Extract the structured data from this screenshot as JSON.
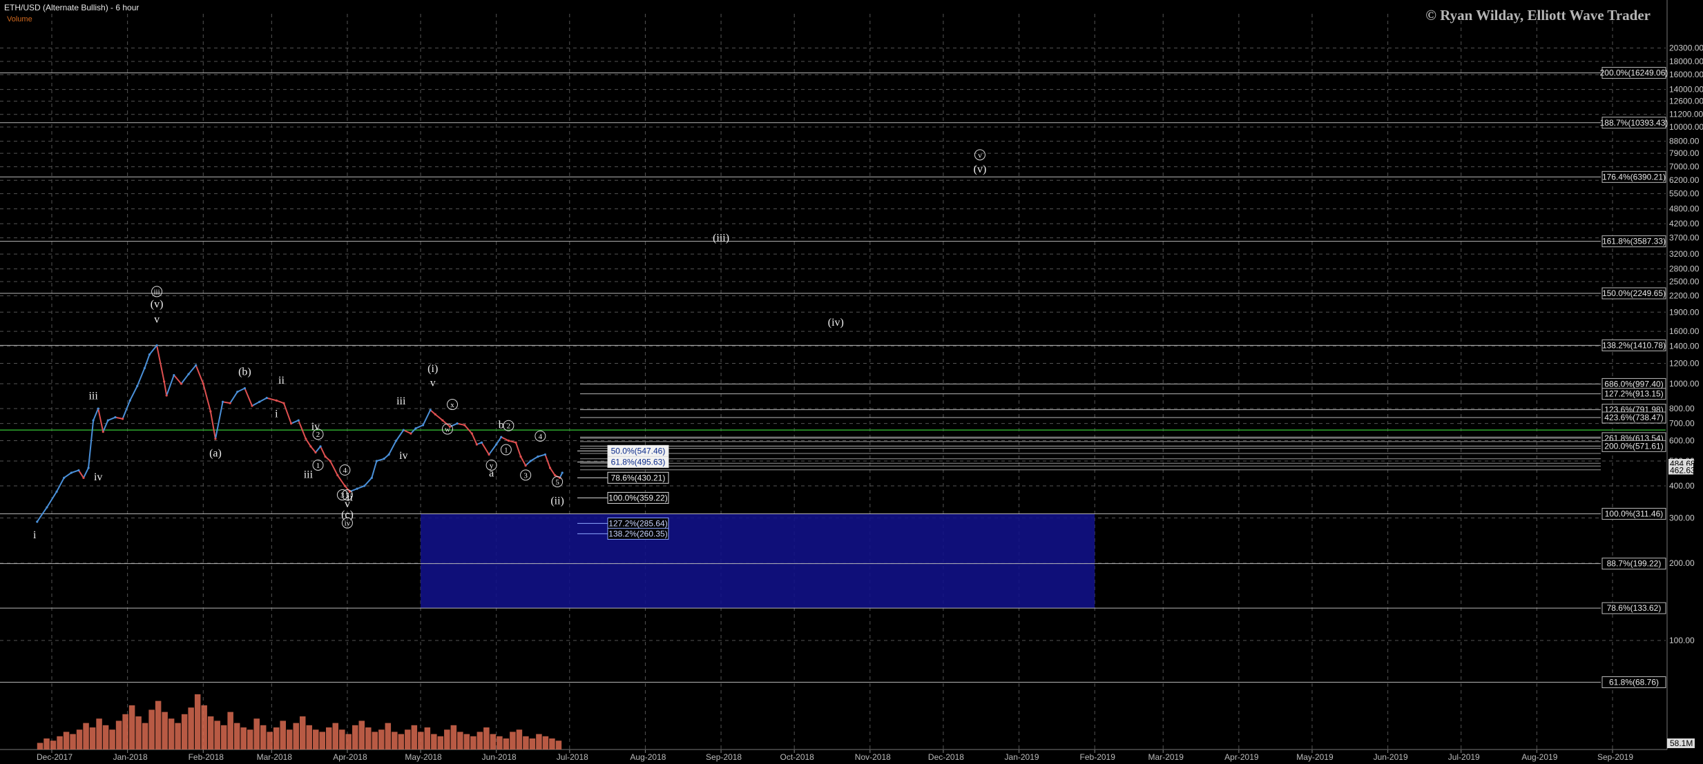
{
  "header": {
    "title": "ETH/USD (Alternate Bullish) - 6 hour",
    "volume_label": "Volume",
    "copyright": "© Ryan Wilday, Elliott Wave Trader"
  },
  "colors": {
    "background": "#000000",
    "grid": "#555555",
    "up_candle": "#4a90d9",
    "down_candle": "#e05050",
    "green_line": "#2ea82e",
    "target_box": "#11118a",
    "volume": "#d86a50"
  },
  "chart_data": {
    "type": "line",
    "scale": "log",
    "title": "ETH/USD (Alternate Bullish) - 6 hour",
    "x_ticks": [
      "Dec-2017",
      "Jan-2018",
      "Feb-2018",
      "Mar-2018",
      "Apr-2018",
      "May-2018",
      "Jun-2018",
      "Jul-2018",
      "Aug-2018",
      "Sep-2018",
      "Oct-2018",
      "Nov-2018",
      "Dec-2018",
      "Jan-2019",
      "Feb-2019",
      "Mar-2019",
      "Apr-2019",
      "May-2019",
      "Jun-2019",
      "Jul-2019",
      "Aug-2019",
      "Sep-2019"
    ],
    "y_ticks": [
      20300,
      18000,
      16000,
      14000,
      12600,
      11200,
      10000,
      8800,
      7900,
      7000,
      6200,
      5500,
      4800,
      4200,
      3700,
      3200,
      2800,
      2500,
      2200,
      1900,
      1600,
      1400,
      1200,
      1000,
      800,
      700,
      600,
      500,
      400,
      300,
      200,
      100
    ],
    "ylim": [
      50,
      20300
    ],
    "price_series": [
      [
        "2017-11-25",
        290
      ],
      [
        "2017-11-29",
        330
      ],
      [
        "2017-12-03",
        380
      ],
      [
        "2017-12-06",
        430
      ],
      [
        "2017-12-09",
        450
      ],
      [
        "2017-12-12",
        460
      ],
      [
        "2017-12-14",
        430
      ],
      [
        "2017-12-16",
        470
      ],
      [
        "2017-12-18",
        720
      ],
      [
        "2017-12-20",
        800
      ],
      [
        "2017-12-22",
        650
      ],
      [
        "2017-12-24",
        720
      ],
      [
        "2017-12-27",
        740
      ],
      [
        "2017-12-30",
        730
      ],
      [
        "2018-01-02",
        860
      ],
      [
        "2018-01-05",
        980
      ],
      [
        "2018-01-08",
        1150
      ],
      [
        "2018-01-10",
        1300
      ],
      [
        "2018-01-13",
        1410
      ],
      [
        "2018-01-16",
        1020
      ],
      [
        "2018-01-17",
        900
      ],
      [
        "2018-01-20",
        1080
      ],
      [
        "2018-01-23",
        1000
      ],
      [
        "2018-01-26",
        1090
      ],
      [
        "2018-01-29",
        1180
      ],
      [
        "2018-02-01",
        1000
      ],
      [
        "2018-02-04",
        780
      ],
      [
        "2018-02-06",
        610
      ],
      [
        "2018-02-09",
        850
      ],
      [
        "2018-02-12",
        840
      ],
      [
        "2018-02-15",
        930
      ],
      [
        "2018-02-18",
        960
      ],
      [
        "2018-02-21",
        820
      ],
      [
        "2018-02-24",
        850
      ],
      [
        "2018-02-27",
        880
      ],
      [
        "2018-03-03",
        860
      ],
      [
        "2018-03-06",
        840
      ],
      [
        "2018-03-09",
        700
      ],
      [
        "2018-03-12",
        720
      ],
      [
        "2018-03-15",
        610
      ],
      [
        "2018-03-17",
        570
      ],
      [
        "2018-03-19",
        540
      ],
      [
        "2018-03-21",
        570
      ],
      [
        "2018-03-23",
        520
      ],
      [
        "2018-03-25",
        500
      ],
      [
        "2018-03-28",
        440
      ],
      [
        "2018-03-31",
        400
      ],
      [
        "2018-04-02",
        380
      ],
      [
        "2018-04-05",
        390
      ],
      [
        "2018-04-08",
        400
      ],
      [
        "2018-04-11",
        430
      ],
      [
        "2018-04-13",
        500
      ],
      [
        "2018-04-16",
        510
      ],
      [
        "2018-04-18",
        530
      ],
      [
        "2018-04-21",
        600
      ],
      [
        "2018-04-24",
        660
      ],
      [
        "2018-04-27",
        640
      ],
      [
        "2018-04-29",
        670
      ],
      [
        "2018-05-02",
        690
      ],
      [
        "2018-05-05",
        790
      ],
      [
        "2018-05-07",
        760
      ],
      [
        "2018-05-10",
        720
      ],
      [
        "2018-05-13",
        680
      ],
      [
        "2018-05-16",
        700
      ],
      [
        "2018-05-19",
        690
      ],
      [
        "2018-05-22",
        640
      ],
      [
        "2018-05-24",
        580
      ],
      [
        "2018-05-26",
        590
      ],
      [
        "2018-05-29",
        530
      ],
      [
        "2018-06-01",
        580
      ],
      [
        "2018-06-03",
        620
      ],
      [
        "2018-06-06",
        600
      ],
      [
        "2018-06-09",
        590
      ],
      [
        "2018-06-11",
        520
      ],
      [
        "2018-06-13",
        480
      ],
      [
        "2018-06-15",
        500
      ],
      [
        "2018-06-18",
        520
      ],
      [
        "2018-06-21",
        530
      ],
      [
        "2018-06-23",
        470
      ],
      [
        "2018-06-25",
        440
      ],
      [
        "2018-06-27",
        430
      ],
      [
        "2018-06-28",
        450
      ]
    ],
    "horizontal_levels": [
      {
        "label": "200.0%(16249.06)",
        "value": 16249.06
      },
      {
        "label": "188.7%(10393.43)",
        "value": 10393.43
      },
      {
        "label": "176.4%(6390.21)",
        "value": 6390.21
      },
      {
        "label": "161.8%(3587.33)",
        "value": 3587.33
      },
      {
        "label": "150.0%(2249.65)",
        "value": 2249.65
      },
      {
        "label": "138.2%(1410.78)",
        "value": 1410.78
      },
      {
        "label": "686.0%(997.40)",
        "value": 997.4
      },
      {
        "label": "127.2%(913.15)",
        "value": 913.15
      },
      {
        "label": "123.6%(791.98)",
        "value": 791.98
      },
      {
        "label": "423.6%(738.47)",
        "value": 738.47
      },
      {
        "label": "261.8%(613.54)",
        "value": 613.54
      },
      {
        "label": "200.0%(571.61)",
        "value": 571.61
      },
      {
        "label": "100.0%(311.46)",
        "value": 311.46
      },
      {
        "label": "88.7%(199.22)",
        "value": 199.22
      },
      {
        "label": "78.6%(133.62)",
        "value": 133.62
      },
      {
        "label": "61.8%(68.76)",
        "value": 68.76
      }
    ],
    "current_price_labels": [
      "484.68",
      "462.63"
    ],
    "volume_readout": "58.1M",
    "green_line_value": 660,
    "fib_tags": [
      {
        "label": "50.0%(547.46)",
        "value": 547.46,
        "style": "boxed"
      },
      {
        "label": "61.8%(495.63)",
        "value": 495.63,
        "style": "boxed"
      },
      {
        "label": "78.6%(430.21)",
        "value": 430.21,
        "style": "plain"
      },
      {
        "label": "100.0%(359.22)",
        "value": 359.22,
        "style": "plain"
      },
      {
        "label": "127.2%(285.64)",
        "value": 285.64,
        "style": "blue"
      },
      {
        "label": "138.2%(260.35)",
        "value": 260.35,
        "style": "blue"
      }
    ],
    "target_box": {
      "x_start": "2018-05-01",
      "x_end": "2019-02-01",
      "y_low": 133.62,
      "y_high": 311.46
    },
    "wave_labels": [
      {
        "t": "i",
        "d": "2017-11-24",
        "v": 250
      },
      {
        "t": "iii",
        "d": "2017-12-18",
        "v": 870
      },
      {
        "t": "iv",
        "d": "2017-12-20",
        "v": 420
      },
      {
        "t": "iii",
        "d": "2018-01-13",
        "v": 2230,
        "circled": true
      },
      {
        "t": "(v)",
        "d": "2018-01-13",
        "v": 1980
      },
      {
        "t": "v",
        "d": "2018-01-13",
        "v": 1730
      },
      {
        "t": "(a)",
        "d": "2018-02-06",
        "v": 520
      },
      {
        "t": "(b)",
        "d": "2018-02-18",
        "v": 1080
      },
      {
        "t": "i",
        "d": "2018-03-03",
        "v": 740
      },
      {
        "t": "ii",
        "d": "2018-03-05",
        "v": 1000
      },
      {
        "t": "iv",
        "d": "2018-03-19",
        "v": 660
      },
      {
        "t": "2",
        "d": "2018-03-20",
        "v": 620,
        "circled": true
      },
      {
        "t": "1",
        "d": "2018-03-20",
        "v": 470,
        "circled": true
      },
      {
        "t": "iii",
        "d": "2018-03-16",
        "v": 430
      },
      {
        "t": "4",
        "d": "2018-03-31",
        "v": 450,
        "circled": true
      },
      {
        "t": "3",
        "d": "2018-03-30",
        "v": 360,
        "circled": true
      },
      {
        "t": "5",
        "d": "2018-04-01",
        "v": 360,
        "circled": true
      },
      {
        "t": "ii",
        "d": "2018-04-02",
        "v": 350
      },
      {
        "t": "v",
        "d": "2018-04-01",
        "v": 330
      },
      {
        "t": "(c)",
        "d": "2018-04-01",
        "v": 300
      },
      {
        "t": "iv",
        "d": "2018-04-01",
        "v": 280,
        "circled": true
      },
      {
        "t": "iii",
        "d": "2018-04-23",
        "v": 830
      },
      {
        "t": "iv",
        "d": "2018-04-24",
        "v": 510
      },
      {
        "t": "(i)",
        "d": "2018-05-06",
        "v": 1110
      },
      {
        "t": "v",
        "d": "2018-05-06",
        "v": 980
      },
      {
        "t": "x",
        "d": "2018-05-14",
        "v": 810,
        "circled": true
      },
      {
        "t": "w",
        "d": "2018-05-12",
        "v": 650,
        "circled": true
      },
      {
        "t": "y",
        "d": "2018-05-30",
        "v": 470,
        "circled": true
      },
      {
        "t": "a",
        "d": "2018-05-30",
        "v": 435
      },
      {
        "t": "b",
        "d": "2018-06-03",
        "v": 670
      },
      {
        "t": "2",
        "d": "2018-06-06",
        "v": 670,
        "circled": true
      },
      {
        "t": "1",
        "d": "2018-06-05",
        "v": 540,
        "circled": true
      },
      {
        "t": "4",
        "d": "2018-06-19",
        "v": 610,
        "circled": true
      },
      {
        "t": "3",
        "d": "2018-06-13",
        "v": 430,
        "circled": true
      },
      {
        "t": "5",
        "d": "2018-06-26",
        "v": 405,
        "circled": true
      },
      {
        "t": "(ii)",
        "d": "2018-06-26",
        "v": 340
      },
      {
        "t": "(iii)",
        "d": "2018-09-01",
        "v": 3590
      },
      {
        "t": "(iv)",
        "d": "2018-10-18",
        "v": 1680
      },
      {
        "t": "v",
        "d": "2018-12-16",
        "v": 7600,
        "circled": true
      },
      {
        "t": "(v)",
        "d": "2018-12-16",
        "v": 6650
      }
    ],
    "volume_series": [
      3,
      5,
      4,
      6,
      8,
      7,
      9,
      12,
      10,
      14,
      11,
      9,
      13,
      16,
      20,
      15,
      12,
      18,
      22,
      17,
      14,
      12,
      16,
      19,
      25,
      20,
      15,
      13,
      11,
      17,
      12,
      10,
      9,
      14,
      11,
      8,
      10,
      13,
      9,
      12,
      15,
      11,
      9,
      8,
      10,
      12,
      9,
      7,
      11,
      13,
      10,
      8,
      9,
      12,
      8,
      7,
      9,
      11,
      8,
      10,
      7,
      6,
      9,
      11,
      8,
      7,
      6,
      8,
      10,
      7,
      6,
      5,
      8,
      9,
      6,
      5,
      7,
      6,
      5,
      4
    ]
  }
}
